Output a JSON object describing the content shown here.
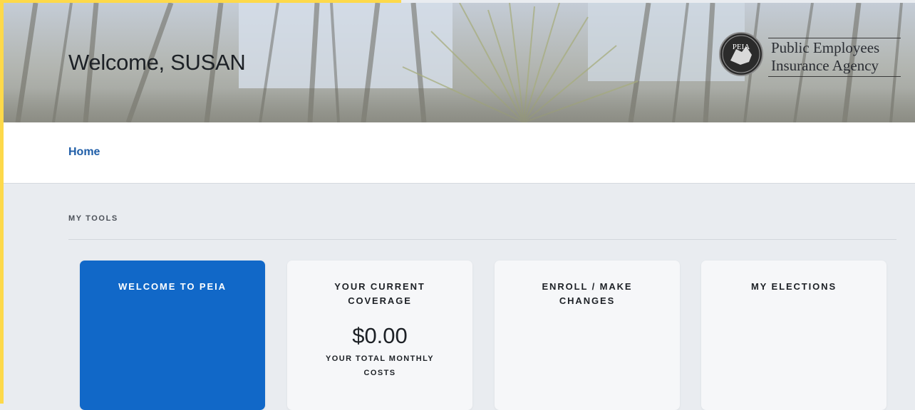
{
  "header": {
    "welcome": "Welcome, SUSAN",
    "logo": {
      "line1": "Public Employees",
      "line2": "Insurance Agency",
      "seal_text": "PEIA"
    }
  },
  "nav": {
    "home": "Home"
  },
  "tools": {
    "label": "MY TOOLS",
    "cards": [
      {
        "title": "WELCOME TO PEIA"
      },
      {
        "title": "YOUR CURRENT COVERAGE",
        "amount": "$0.00",
        "subtitle": "YOUR TOTAL MONTHLY COSTS"
      },
      {
        "title": "ENROLL / MAKE CHANGES"
      },
      {
        "title": "MY ELECTIONS"
      }
    ]
  },
  "colors": {
    "accent_border": "#fdd94a",
    "primary_blue": "#1168c8",
    "link_blue": "#1f5ea8",
    "page_bg": "#e9ecf0"
  }
}
